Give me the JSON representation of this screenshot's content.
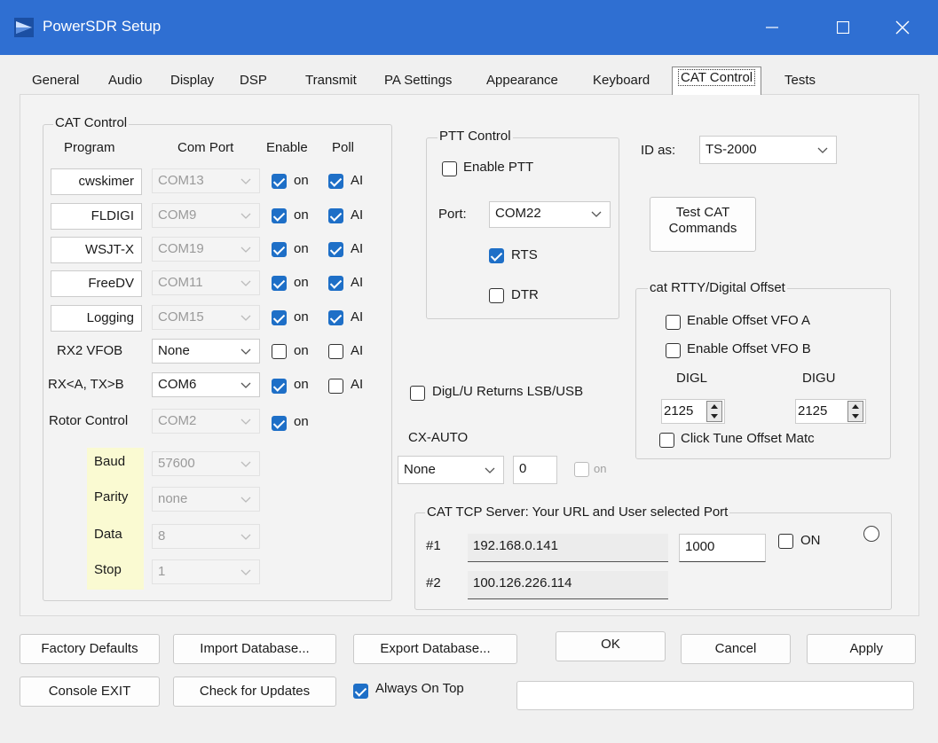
{
  "window": {
    "title": "PowerSDR Setup",
    "accent": "#2f6fd2"
  },
  "tabs": [
    "General",
    "Audio",
    "Display",
    "DSP",
    "Transmit",
    "PA Settings",
    "Appearance",
    "Keyboard",
    "CAT Control",
    "Tests"
  ],
  "active_tab": "CAT Control",
  "cat_control": {
    "group_label": "CAT Control",
    "headers": {
      "program": "Program",
      "com_port": "Com Port",
      "enable": "Enable",
      "poll": "Poll"
    },
    "programs": [
      {
        "name": "cwskimer",
        "port": "COM13",
        "enable_label": "on",
        "enabled": true,
        "poll_label": "AI",
        "poll": true
      },
      {
        "name": "FLDIGI",
        "port": "COM9",
        "enable_label": "on",
        "enabled": true,
        "poll_label": "AI",
        "poll": true
      },
      {
        "name": "WSJT-X",
        "port": "COM19",
        "enable_label": "on",
        "enabled": true,
        "poll_label": "AI",
        "poll": true
      },
      {
        "name": "FreeDV",
        "port": "COM11",
        "enable_label": "on",
        "enabled": true,
        "poll_label": "AI",
        "poll": true
      },
      {
        "name": "Logging",
        "port": "COM15",
        "enable_label": "on",
        "enabled": true,
        "poll_label": "AI",
        "poll": true
      }
    ],
    "rx2_vfob": {
      "label": "RX2 VFOB",
      "port": "None",
      "enable_label": "on",
      "enabled": false,
      "poll_label": "AI",
      "poll": false
    },
    "rx_tx": {
      "label": "RX<A, TX>B",
      "port": "COM6",
      "enable_label": "on",
      "enabled": true,
      "poll_label": "AI",
      "poll": false
    },
    "rotor": {
      "label": "Rotor Control",
      "port": "COM2",
      "enable_label": "on",
      "enabled": true
    },
    "serial": [
      {
        "label": "Baud",
        "value": "57600"
      },
      {
        "label": "Parity",
        "value": "none"
      },
      {
        "label": "Data",
        "value": "8"
      },
      {
        "label": "Stop",
        "value": "1"
      }
    ]
  },
  "ptt": {
    "group_label": "PTT Control",
    "enable_label": "Enable PTT",
    "enabled": false,
    "port_label": "Port:",
    "port": "COM22",
    "rts_label": "RTS",
    "rts": true,
    "dtr_label": "DTR",
    "dtr": false
  },
  "id_as": {
    "label": "ID as:",
    "value": "TS-2000"
  },
  "test_cat_button": [
    "Test CAT",
    "Commands"
  ],
  "rtty_offset": {
    "group_label": "cat RTTY/Digital Offset",
    "enable_vfo_a": "Enable Offset VFO A",
    "enable_vfo_b": "Enable Offset VFO B",
    "digl_label": "DIGL",
    "digu_label": "DIGU",
    "digl_value": "2125",
    "digu_value": "2125",
    "click_tune": "Click Tune Offset Matc"
  },
  "digl_u_returns": "DigL/U Returns LSB/USB",
  "cx_auto": {
    "label": "CX-AUTO",
    "value": "None",
    "number": "0",
    "on_label": "on"
  },
  "tcp": {
    "group_label": "CAT TCP Server:  Your URL and User selected Port",
    "row1_label": "#1",
    "row1_ip": "192.168.0.141",
    "row1_port": "1000",
    "on_label": "ON",
    "row2_label": "#2",
    "row2_ip": "100.126.226.114"
  },
  "buttons": {
    "factory_defaults": "Factory Defaults",
    "import_db": "Import Database...",
    "export_db": "Export Database...",
    "ok": "OK",
    "cancel": "Cancel",
    "apply": "Apply",
    "console_exit": "Console EXIT",
    "check_updates": "Check for Updates",
    "always_on_top": "Always On Top"
  },
  "status_text": ""
}
